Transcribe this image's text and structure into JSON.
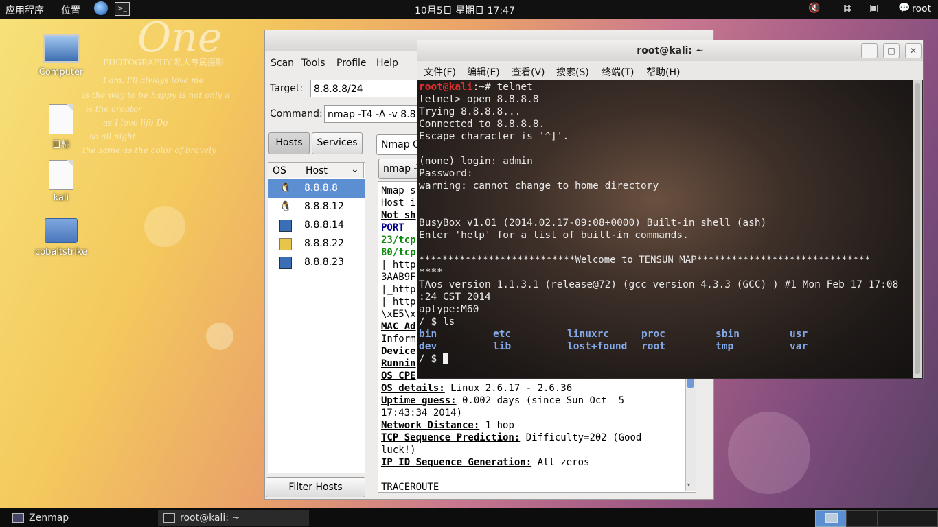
{
  "top_panel": {
    "apps_label": "应用程序",
    "places_label": "位置",
    "clock": "10月5日 星期日 17:47",
    "user": "root"
  },
  "desktop": {
    "icons": [
      {
        "label": "Computer",
        "icon": "computer-icon"
      },
      {
        "label": "目标",
        "icon": "file-icon"
      },
      {
        "label": "kali",
        "icon": "file-icon"
      },
      {
        "label": "cobaltstrike",
        "icon": "folder-icon"
      }
    ],
    "wallpaper_text": [
      "One",
      "PHOTOGRAPHY 私人专属摄影",
      "I am. I'll always love me",
      "is the way to be happy is not only a",
      "is the creator",
      "as I love life Do",
      "so all night",
      "the same as the color of bravely"
    ]
  },
  "zenmap": {
    "menu": [
      "Scan",
      "Tools",
      "Profile",
      "Help"
    ],
    "target_label": "Target:",
    "target_value": "8.8.8.8/24",
    "command_label": "Command:",
    "command_value": "nmap -T4 -A -v 8.8.8",
    "hosts_button": "Hosts",
    "services_button": "Services",
    "col_os": "OS",
    "col_host": "Host",
    "hosts": [
      {
        "ip": "8.8.8.8",
        "os_icon": "linux-penguin-icon",
        "selected": true
      },
      {
        "ip": "8.8.8.12",
        "os_icon": "linux-penguin-icon",
        "selected": false
      },
      {
        "ip": "8.8.8.14",
        "os_icon": "unknown-os-icon",
        "selected": false
      },
      {
        "ip": "8.8.8.22",
        "os_icon": "unknown-os-icon",
        "selected": false
      },
      {
        "ip": "8.8.8.23",
        "os_icon": "unknown-os-icon",
        "selected": false
      }
    ],
    "tab_label": "Nmap O",
    "profile_combo": "nmap -T",
    "filter_button": "Filter Hosts",
    "output_partial": [
      "Nmap s",
      "Host i",
      "Not sh",
      "PORT",
      "23/tcp",
      "80/tcp",
      "|_http",
      "3AAB9F",
      "|_http",
      "|_http",
      "\\xE5\\x",
      "MAC Ad",
      "Inform",
      "Device",
      "Runnin",
      "OS CPE"
    ],
    "output_full": {
      "os_details_key": "OS details:",
      "os_details_val": " Linux 2.6.17 - 2.6.36",
      "uptime_key": "Uptime guess:",
      "uptime_val": " 0.002 days (since Sun Oct  5",
      "uptime_val2": "17:43:34 2014)",
      "netdist_key": "Network Distance:",
      "netdist_val": " 1 hop",
      "tcpseq_key": "TCP Sequence Prediction:",
      "tcpseq_val": " Difficulty=202 (Good",
      "tcpseq_val2": "luck!)",
      "ipid_key": "IP ID Sequence Generation:",
      "ipid_val": " All zeros",
      "traceroute": "TRACEROUTE"
    }
  },
  "terminal": {
    "title": "root@kali: ~",
    "menu": [
      "文件(F)",
      "编辑(E)",
      "查看(V)",
      "搜索(S)",
      "终端(T)",
      "帮助(H)"
    ],
    "prompt_user": "root@kali",
    "prompt_rest": ":~# telnet",
    "lines": [
      "telnet> open 8.8.8.8",
      "Trying 8.8.8.8...",
      "Connected to 8.8.8.8.",
      "Escape character is '^]'.",
      "",
      "(none) login: admin",
      "Password:",
      "warning: cannot change to home directory",
      "",
      "",
      "",
      "BusyBox v1.01 (2014.02.17-09:08+0000) Built-in shell (ash)",
      "Enter 'help' for a list of built-in commands.",
      "",
      "***************************Welcome to TENSUN MAP******************************",
      "****",
      "TAos version 1.1.3.1 (release@72) (gcc version 4.3.3 (GCC) ) #1 Mon Feb 17 17:08",
      ":24 CST 2014",
      "aptype:M60",
      "/ $ ls"
    ],
    "ls_row1": [
      "bin",
      "etc",
      "linuxrc",
      "proc",
      "sbin",
      "usr"
    ],
    "ls_row2": [
      "dev",
      "lib",
      "lost+found",
      "root",
      "tmp",
      "var"
    ],
    "final_prompt": "/ $ "
  },
  "taskbar": {
    "tasks": [
      {
        "label": "Zenmap",
        "icon": "zenmap-window-icon"
      },
      {
        "label": "root@kali: ~",
        "icon": "terminal-icon"
      }
    ]
  },
  "colors": {
    "prompt_red": "#e03030",
    "ls_dir_blue": "#84a9e8",
    "selection_blue": "#5b8fd2"
  }
}
